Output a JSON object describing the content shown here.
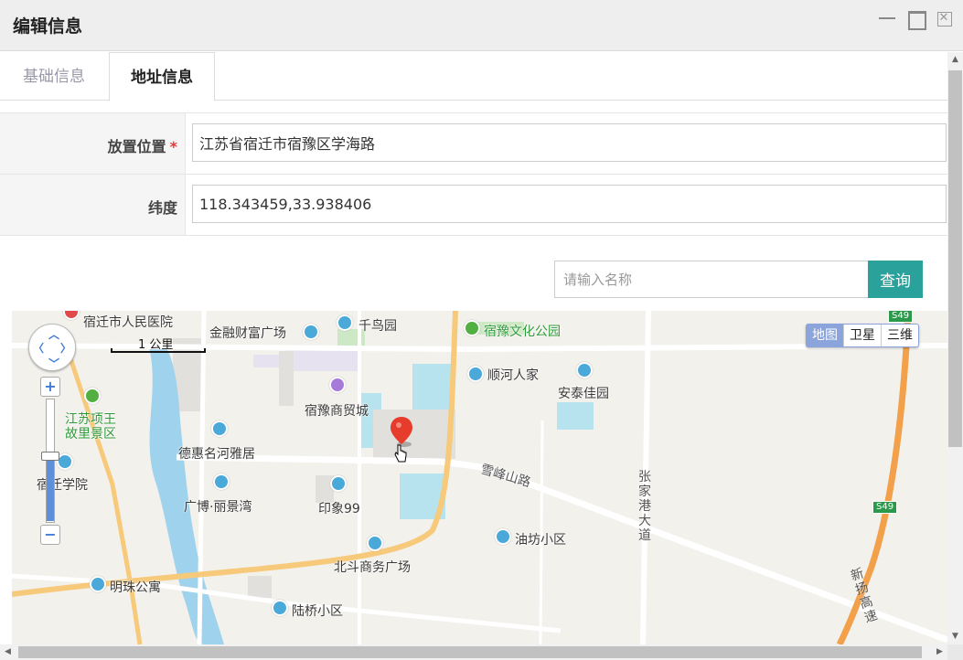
{
  "window": {
    "title": "编辑信息"
  },
  "tabs": [
    {
      "label": "基础信息",
      "active": false
    },
    {
      "label": "地址信息",
      "active": true
    }
  ],
  "form": {
    "location_label": "放置位置",
    "location_required_mark": "*",
    "location_value": "江苏省宿迁市宿豫区学海路",
    "latlng_label": "纬度",
    "latlng_value": "118.343459,33.938406"
  },
  "search": {
    "placeholder": "请输入名称",
    "button_label": "查询"
  },
  "map": {
    "type_buttons": [
      {
        "label": "地图",
        "active": true
      },
      {
        "label": "卫星",
        "active": false
      },
      {
        "label": "三维",
        "active": false
      }
    ],
    "scale_label": "1 公里",
    "poi": {
      "hospital": "宿迁市人民医院",
      "jinrong": "金融财富广场",
      "qianniao": "千鸟园",
      "suyu_park": "宿豫文化公园",
      "shunhe": "顺河人家",
      "antai": "安泰佳园",
      "shangmao": "宿豫商贸城",
      "xiangwang_1": "江苏项王",
      "xiangwang_2": "故里景区",
      "dehui": "德惠名河雅居",
      "college": "宿迁学院",
      "guangbo": "广博·丽景湾",
      "yinxiang": "印象99",
      "beidou": "北斗商务广场",
      "youfang": "油坊小区",
      "mingzhu": "明珠公寓",
      "luqiao": "陆桥小区"
    },
    "roads": {
      "xuefeng": "雪峰山路",
      "zhangjiagang": "张家港大道",
      "xinyang": "新扬高速"
    },
    "highway_badges": [
      "S49",
      "S49"
    ],
    "icons": {
      "nav": "pan-control-icon",
      "marker": "location-pin-icon",
      "cursor": "hand-cursor-icon"
    }
  }
}
